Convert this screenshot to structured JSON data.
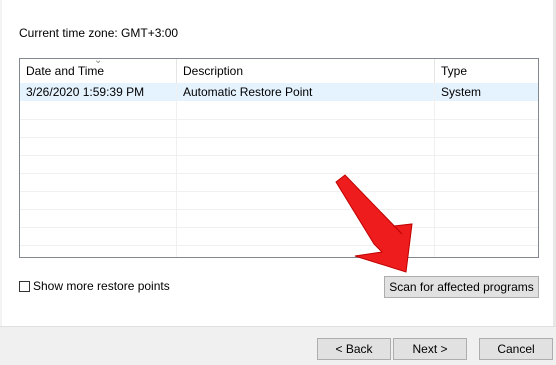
{
  "timezone": {
    "label": "Current time zone: GMT+3:00"
  },
  "table": {
    "columns": [
      "Date and Time",
      "Description",
      "Type"
    ],
    "rows": [
      {
        "date": "3/26/2020 1:59:39 PM",
        "description": "Automatic Restore Point",
        "type": "System"
      }
    ]
  },
  "show_more": {
    "label": "Show more restore points",
    "checked": false
  },
  "scan_button": {
    "label": "Scan for affected programs"
  },
  "nav": {
    "back": "< Back",
    "next": "Next >",
    "cancel": "Cancel"
  },
  "colors": {
    "selection": "#e5f3ff",
    "arrow": "#ee1c1c",
    "button_bg": "#e1e1e1"
  },
  "icons": {
    "sort": "chevron-down-icon",
    "arrow": "red-arrow-annotation"
  }
}
